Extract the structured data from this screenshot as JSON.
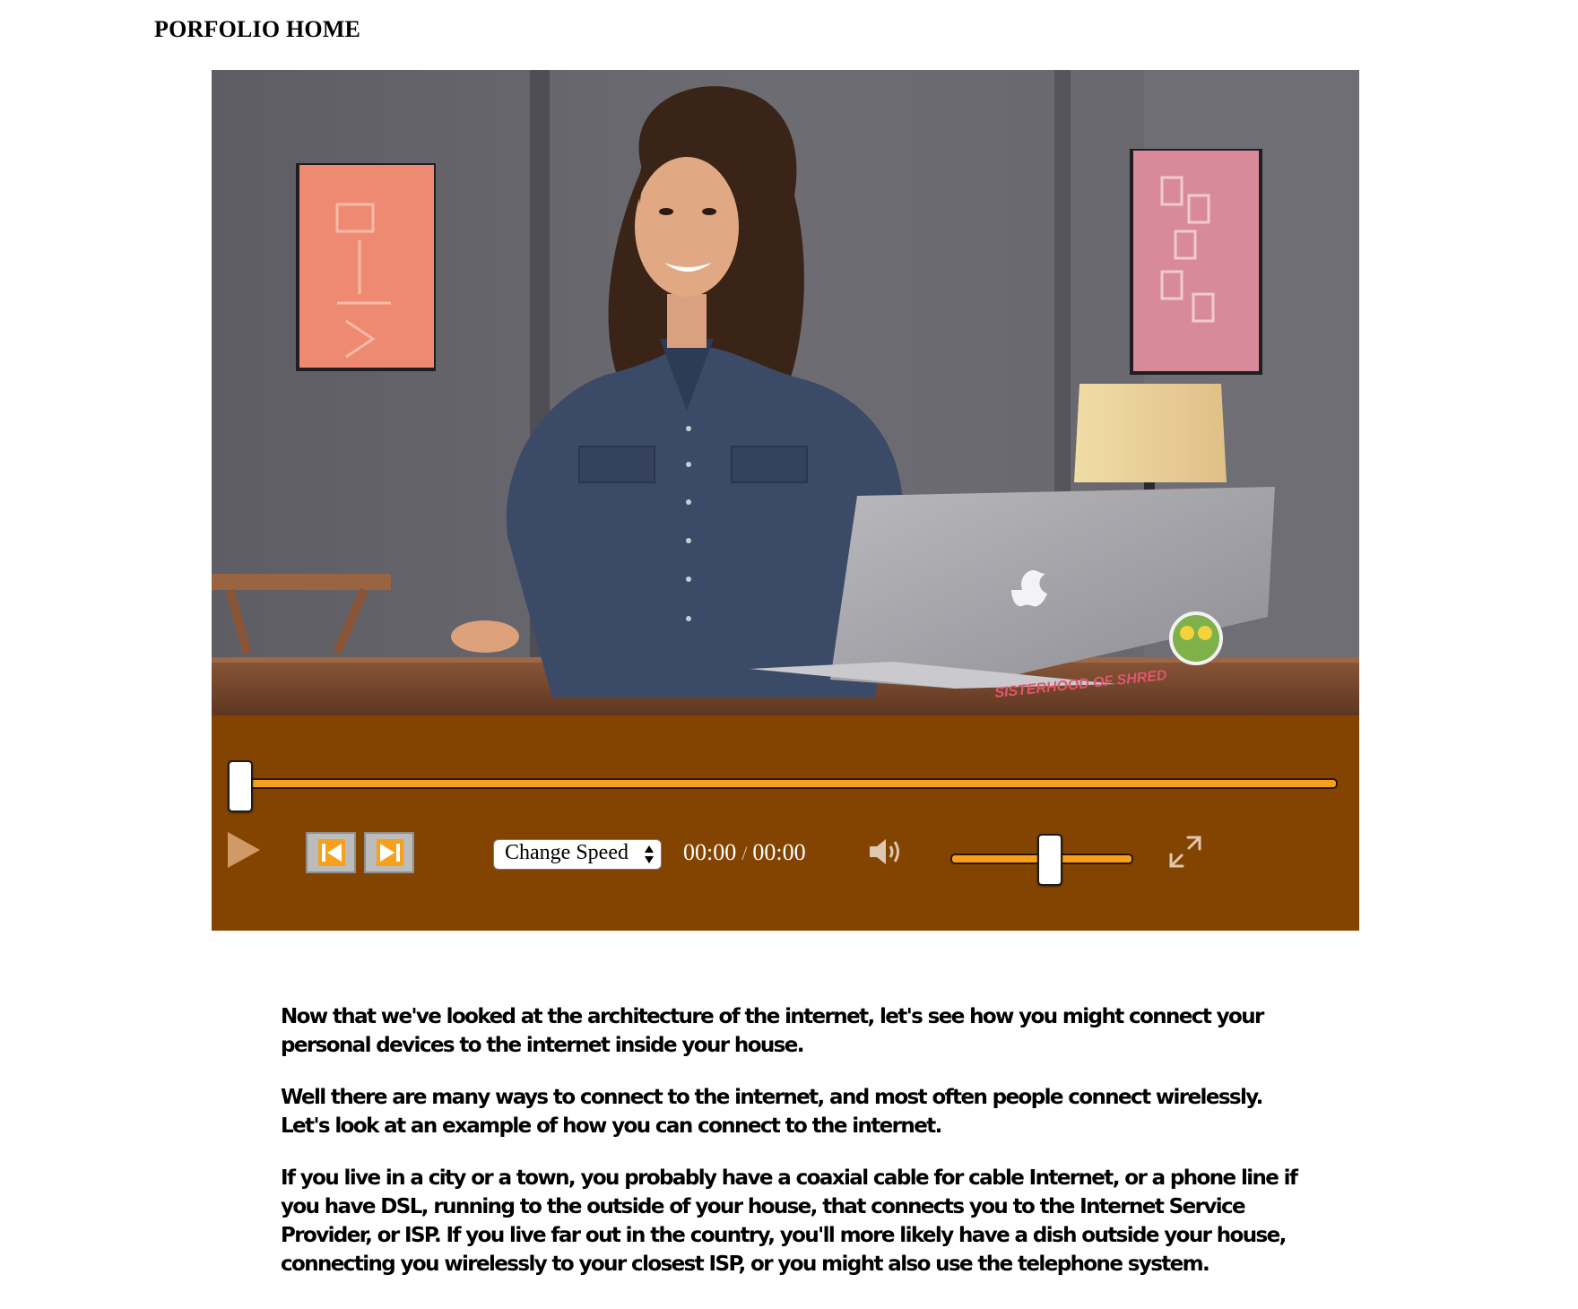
{
  "nav": {
    "home_label": "PORFOLIO HOME"
  },
  "player": {
    "speed_label": "Change Speed",
    "current_time": "00:00",
    "time_separator": "/",
    "duration": "00:00",
    "progress": 0.0,
    "volume": 0.5,
    "laptop_sticker_text": "SISTERHOOD OF SHRED",
    "icons": {
      "play": "play-icon",
      "skip_back": "skip-back-icon",
      "skip_forward": "skip-forward-icon",
      "volume": "volume-icon",
      "fullscreen": "fullscreen-icon"
    },
    "colors": {
      "control_bar": "#844401",
      "accent": "#f7a01b"
    }
  },
  "transcript": {
    "paragraphs": [
      "Now that we've looked at the architecture of the internet, let's see how you might connect your personal devices to the internet inside your house.",
      "Well there are many ways to connect to the internet, and most often people connect wirelessly. Let's look at an example of how you can connect to the internet.",
      "If you live in a city or a town, you probably have a coaxial cable for cable Internet, or a phone line if you have DSL, running to the outside of your house, that connects you to the Internet Service Provider, or ISP. If you live far out in the country, you'll more likely have a dish outside your house, connecting you wirelessly to your closest ISP, or you might also use the telephone system."
    ]
  }
}
